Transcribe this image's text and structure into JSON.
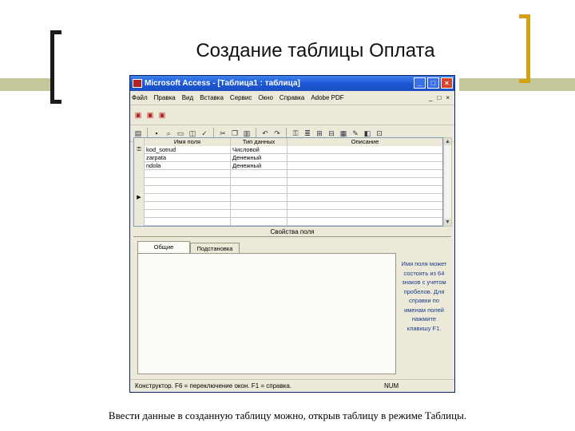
{
  "slide": {
    "title": "Создание таблицы Оплата",
    "caption": "Ввести данные в созданную таблицу можно, открыв таблицу в режиме Таблицы."
  },
  "window": {
    "title": "Microsoft Access - [Таблица1 : таблица]",
    "buttons": [
      "_",
      "□",
      "×"
    ]
  },
  "menu": [
    "Файл",
    "Правка",
    "Вид",
    "Вставка",
    "Сервис",
    "Окно",
    "Справка",
    "Adobe PDF"
  ],
  "doc_controls": [
    "_",
    "□",
    "×"
  ],
  "grid": {
    "headers": [
      "Имя поля",
      "Тип данных",
      "Описание"
    ],
    "rows": [
      {
        "name": "kod_sotrud",
        "type": "Числовой",
        "desc": ""
      },
      {
        "name": "zarpata",
        "type": "Денежный",
        "desc": ""
      },
      {
        "name": "ndola",
        "type": "Денежный",
        "desc": ""
      }
    ]
  },
  "properties": {
    "label": "Свойства поля",
    "tabs": [
      "Общие",
      "Подстановка"
    ],
    "help": "Имя поля может состоять из 64 знаков с учетом пробелов. Для справки по именам полей нажмите клавишу F1."
  },
  "status": {
    "text": "Конструктор. F6 = переключение окон. F1 = справка.",
    "num": "NUM"
  },
  "colors": {
    "title_bar": "#1e58d6",
    "bracket_left": "#1a1a1a",
    "bracket_right": "#d4a017",
    "accent_bar": "#c4c79a"
  }
}
